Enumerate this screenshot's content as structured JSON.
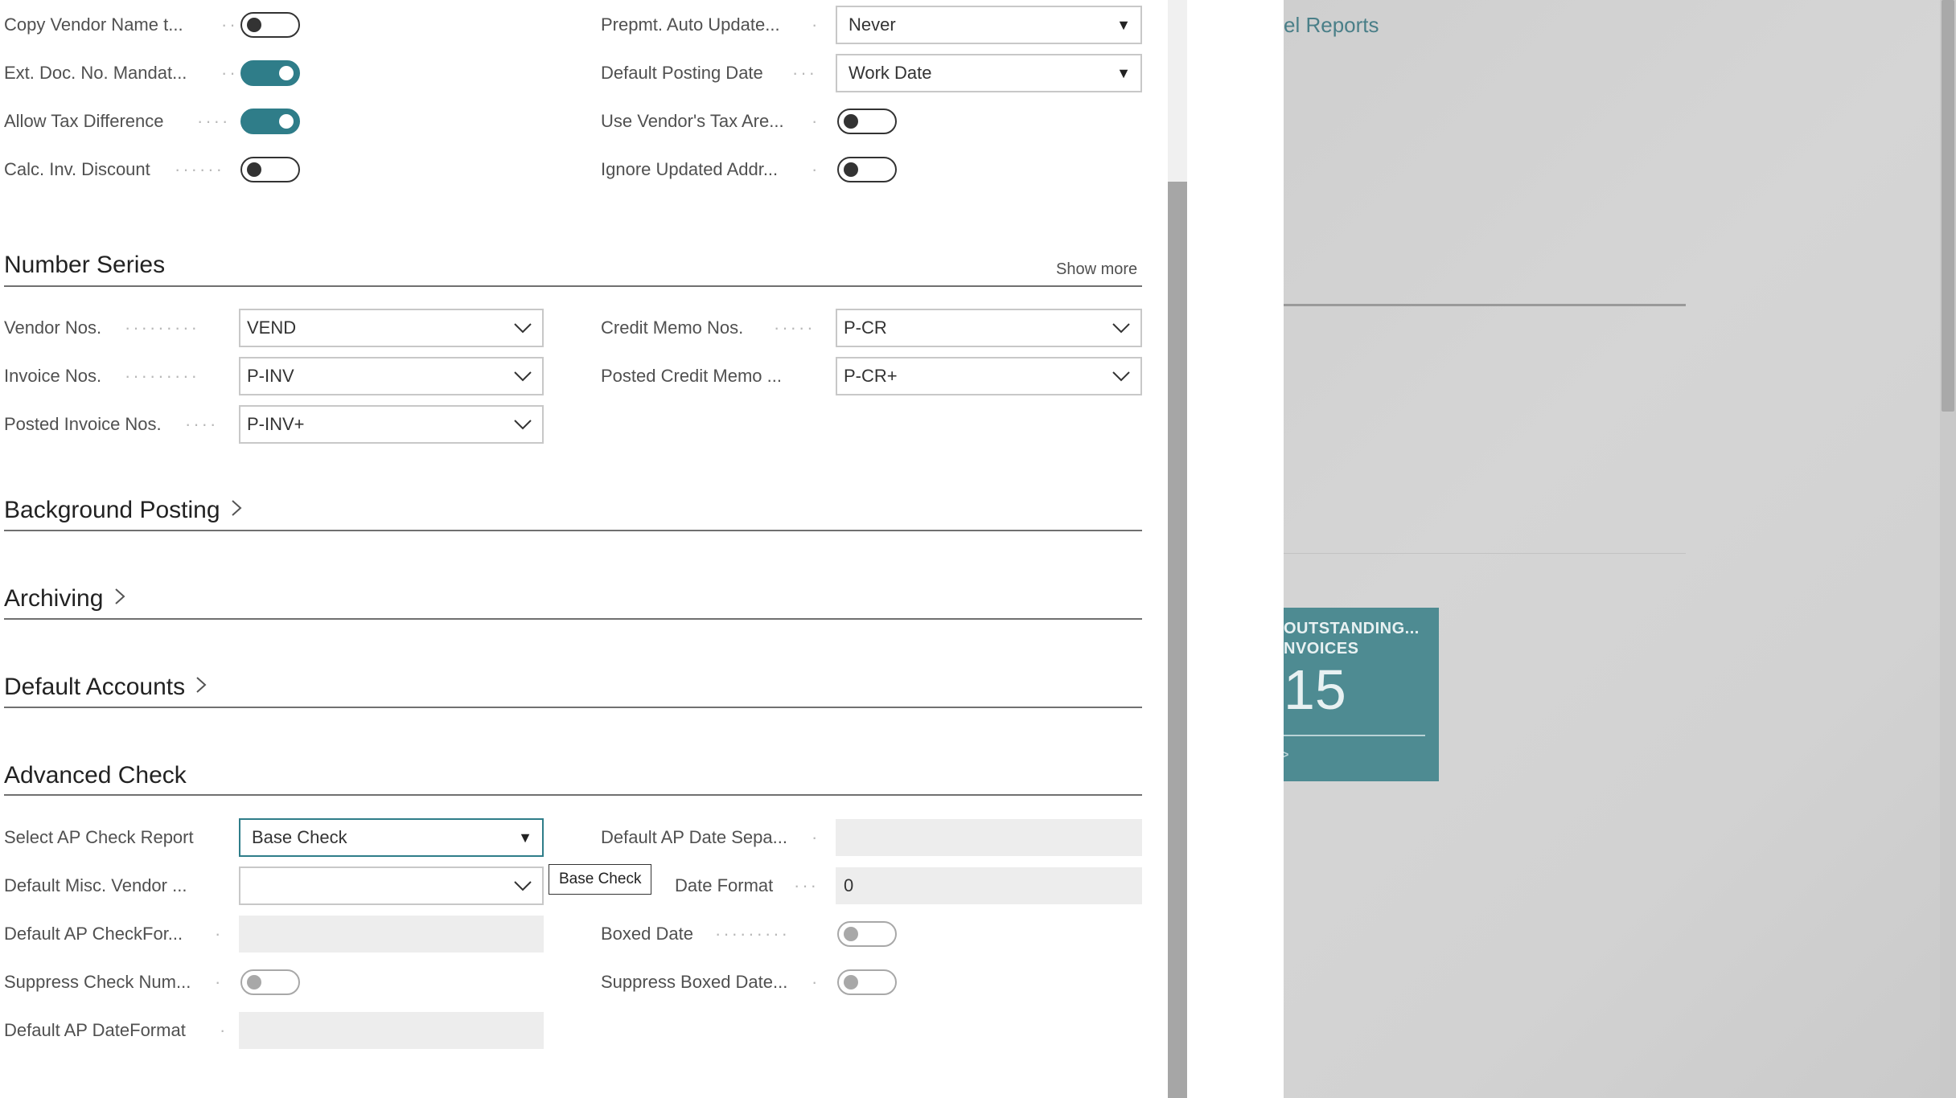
{
  "general": {
    "left": [
      {
        "label": "Copy Vendor Name t...",
        "on": false
      },
      {
        "label": "Ext. Doc. No. Mandat...",
        "on": true
      },
      {
        "label": "Allow Tax Difference",
        "on": true
      },
      {
        "label": "Calc. Inv. Discount",
        "on": false
      }
    ],
    "prepmt_label": "Prepmt. Auto Update...",
    "prepmt_value": "Never",
    "posting_date_label": "Default Posting Date",
    "posting_date_value": "Work Date",
    "use_vendor_tax_label": "Use Vendor's Tax Are...",
    "ignore_updated_label": "Ignore Updated Addr..."
  },
  "number_series": {
    "title": "Number Series",
    "show_more": "Show more",
    "vendor_nos_label": "Vendor Nos.",
    "vendor_nos_value": "VEND",
    "invoice_nos_label": "Invoice Nos.",
    "invoice_nos_value": "P-INV",
    "posted_invoice_label": "Posted Invoice Nos.",
    "posted_invoice_value": "P-INV+",
    "credit_memo_label": "Credit Memo Nos.",
    "credit_memo_value": "P-CR",
    "posted_credit_label": "Posted Credit Memo ...",
    "posted_credit_value": "P-CR+"
  },
  "sections": {
    "background_posting": "Background Posting",
    "archiving": "Archiving",
    "default_accounts": "Default Accounts",
    "advanced_check": "Advanced Check"
  },
  "advanced_check": {
    "select_report_label": "Select AP Check Report",
    "select_report_value": "Base Check",
    "misc_vendor_label": "Default Misc. Vendor ...",
    "checkformat_label": "Default AP CheckFor...",
    "suppress_num_label": "Suppress Check Num...",
    "dateformat_label": "Default AP DateFormat",
    "date_sep_label": "Default AP Date Sepa...",
    "date_format_label": "Date Format",
    "date_format_value": "0",
    "boxed_date_label": "Boxed Date",
    "suppress_boxed_label": "Suppress Boxed Date...",
    "tooltip": "Base Check"
  },
  "background": {
    "link_text": "el Reports",
    "tile_title": "OUTSTANDING...\nNVOICES",
    "tile_count": "15"
  },
  "colors": {
    "accent": "#2f7d89",
    "tile": "#4e8b92",
    "link": "#4a7f88"
  }
}
